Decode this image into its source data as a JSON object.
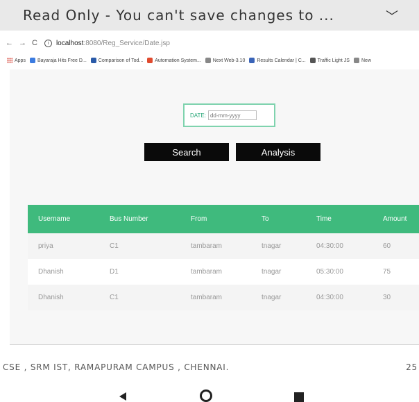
{
  "banner": {
    "text": "Read Only - You can't save changes to ...",
    "chevron": "chevron-down-icon"
  },
  "browser": {
    "back": "←",
    "forward": "→",
    "reload": "C",
    "url_host": "localhost",
    "url_path": ":8080/Reg_Service/Date.jsp"
  },
  "bookmarks": [
    {
      "label": "Apps",
      "color": "#d94b3f"
    },
    {
      "label": "Bayaraja Hits Free D...",
      "color": "#3b7be0"
    },
    {
      "label": "Comparison of Tod...",
      "color": "#2a5aa8"
    },
    {
      "label": "Automation System...",
      "color": "#e04a2e"
    },
    {
      "label": "Next Web-3.10",
      "color": "#888888"
    },
    {
      "label": "Results Calendar | C...",
      "color": "#3a64b8"
    },
    {
      "label": "Traffic Light JS",
      "color": "#555555"
    },
    {
      "label": "New",
      "color": "#888888"
    }
  ],
  "form": {
    "date_label": "DATE:",
    "date_placeholder": "dd-mm-yyyy"
  },
  "buttons": {
    "search": "Search",
    "analysis": "Analysis"
  },
  "table": {
    "headers": [
      "Username",
      "Bus Number",
      "From",
      "To",
      "Time",
      "Amount"
    ],
    "rows": [
      [
        "priya",
        "C1",
        "tambaram",
        "tnagar",
        "04:30:00",
        "60"
      ],
      [
        "Dhanish",
        "D1",
        "tambaram",
        "tnagar",
        "05:30:00",
        "75"
      ],
      [
        "Dhanish",
        "C1",
        "tambaram",
        "tnagar",
        "04:30:00",
        "30"
      ]
    ]
  },
  "footer": {
    "left": "CSE , SRM IST,  RAMAPURAM CAMPUS , CHENNAI.",
    "right": "25"
  },
  "colors": {
    "header_green": "#3fba7d",
    "date_border": "#7fd3ae",
    "button_black": "#0a0a0a"
  }
}
